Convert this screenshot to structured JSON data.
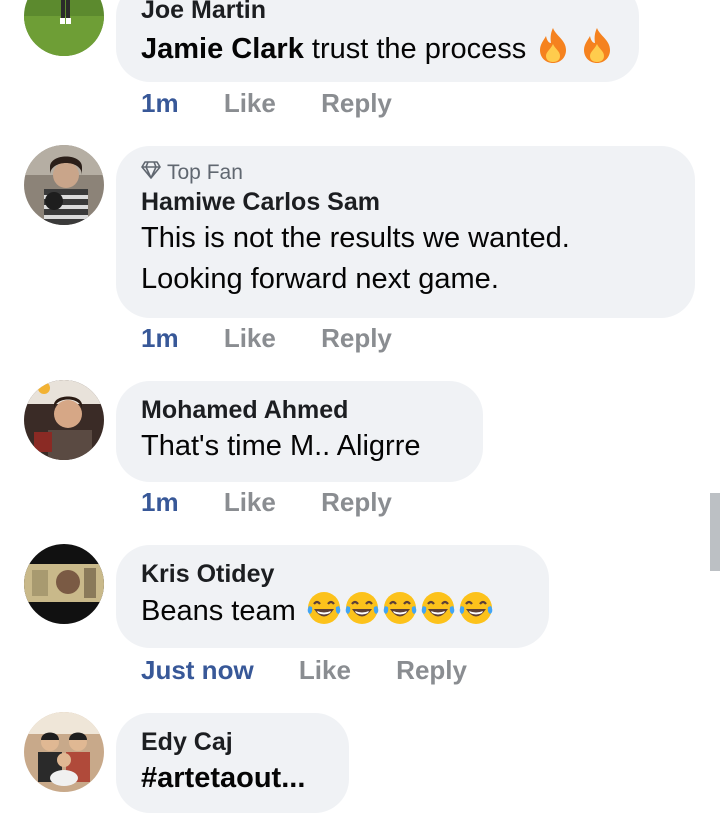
{
  "comments": [
    {
      "author": "Joe Martin",
      "mention": "Jamie Clark",
      "text": " trust the process",
      "emoji": "fire-icon",
      "emoji_count": 2,
      "time": "1m",
      "like": "Like",
      "reply": "Reply"
    },
    {
      "badge": "Top Fan",
      "badge_icon": "diamond-icon",
      "author": "Hamiwe Carlos Sam",
      "text_line1": "This is not the results we wanted.",
      "text_line2": "Looking forward next game.",
      "time": "1m",
      "like": "Like",
      "reply": "Reply"
    },
    {
      "author": "Mohamed Ahmed",
      "text": "That's time M.. Aligrre",
      "time": "1m",
      "like": "Like",
      "reply": "Reply"
    },
    {
      "author": "Kris Otidey",
      "text": "Beans team ",
      "emoji": "face-with-tears-of-joy-icon",
      "emoji_count": 5,
      "time": "Just now",
      "like": "Like",
      "reply": "Reply"
    },
    {
      "author": "Edy Caj",
      "text": "#artetaout..."
    }
  ],
  "colors": {
    "bubble": "#f0f2f5",
    "time_link": "#385898",
    "action_gray": "#8a8d91",
    "fire": "#f5821f",
    "emoji_yellow": "#fcc21b"
  }
}
